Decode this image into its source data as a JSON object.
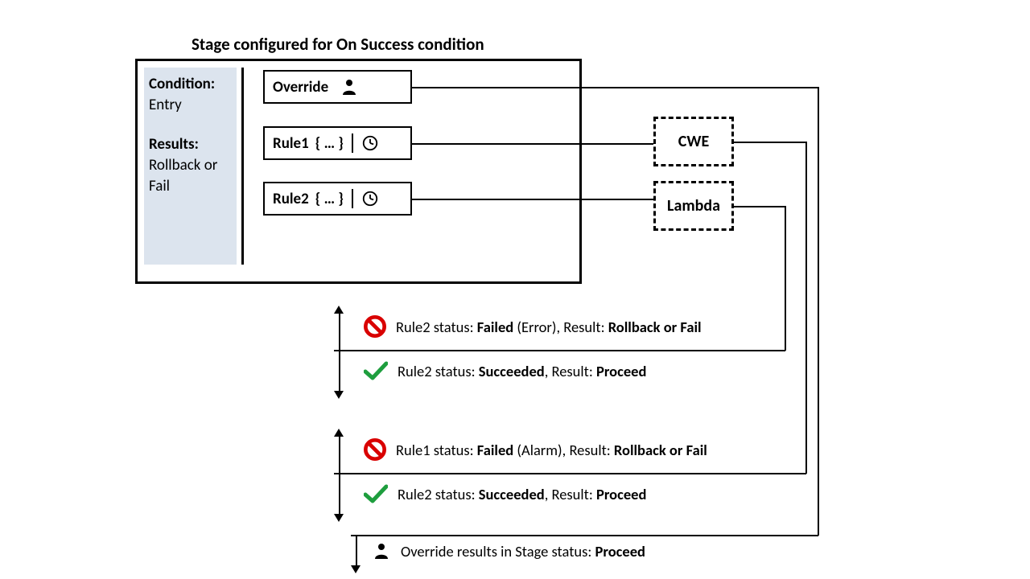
{
  "title": "Stage configured for On Success condition",
  "side": {
    "cond_label": "Condition:",
    "cond_value": "Entry",
    "res_label": "Results:",
    "res_value": "Rollback or Fail"
  },
  "boxes": {
    "override": "Override",
    "rule1_name": "Rule1",
    "rule1_body": "{ … }",
    "rule2_name": "Rule2",
    "rule2_body": "{ … }",
    "cwe": "CWE",
    "lambda": "Lambda"
  },
  "results": {
    "r1_a": {
      "pre": "Rule2 status: ",
      "b1": "Failed",
      "mid1": " (Error), Result: ",
      "b2": "Rollback or Fail"
    },
    "r1_b": {
      "pre": "Rule2 status: ",
      "b1": "Succeeded",
      "mid1": ", Result: ",
      "b2": "Proceed"
    },
    "r2_a": {
      "pre": "Rule1 status: ",
      "b1": "Failed",
      "mid1": " (Alarm), Result: ",
      "b2": "Rollback or Fail"
    },
    "r2_b": {
      "pre": "Rule2 status: ",
      "b1": "Succeeded",
      "mid1": ", Result: ",
      "b2": "Proceed"
    },
    "r3": {
      "pre": "Override results in Stage status: ",
      "b1": "Proceed"
    }
  }
}
